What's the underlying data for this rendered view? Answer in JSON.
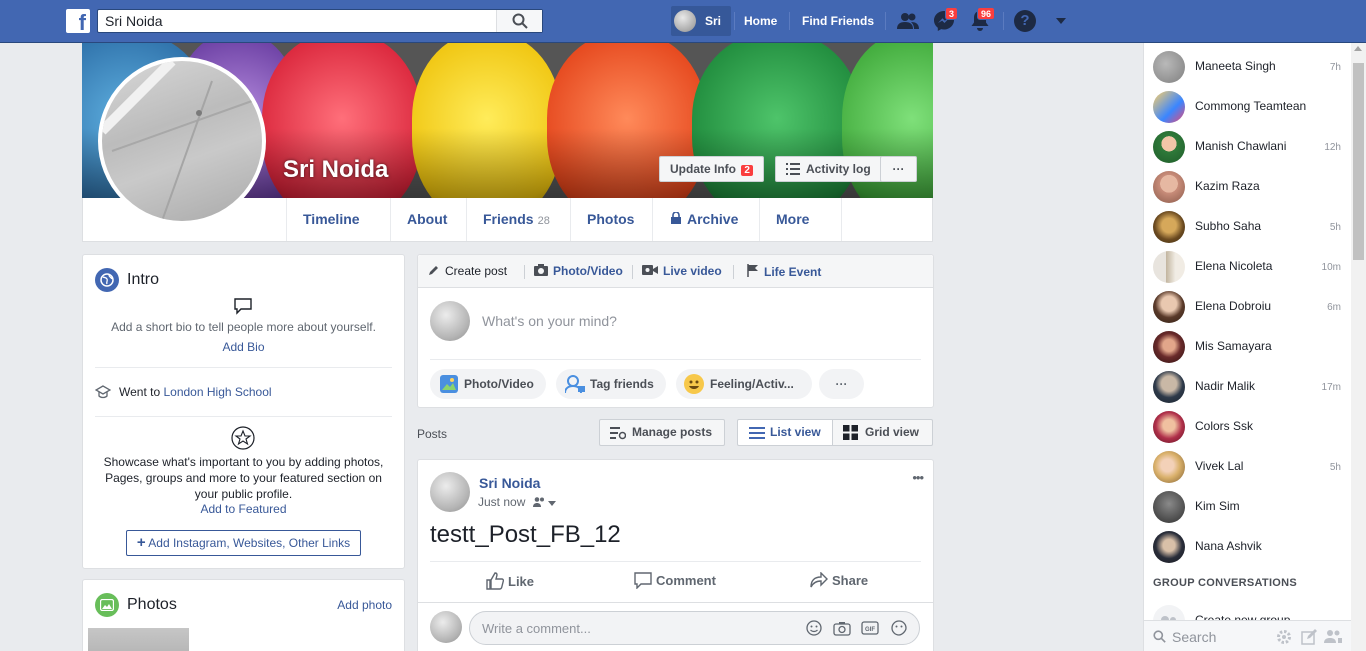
{
  "topbar": {
    "logo": "f",
    "search_value": "Sri Noida",
    "profile_label": "Sri",
    "home_label": "Home",
    "find_friends_label": "Find Friends",
    "messages_badge": "3",
    "notifications_badge": "96",
    "help_label": "?"
  },
  "profile": {
    "name": "Sri Noida",
    "update_info_label": "Update Info",
    "update_info_badge": "2",
    "activity_log_label": "Activity log",
    "more_dots": "···"
  },
  "tabs": {
    "timeline": "Timeline",
    "about": "About",
    "friends": "Friends",
    "friends_count": "28",
    "photos": "Photos",
    "archive": "Archive",
    "more": "More"
  },
  "intro": {
    "title": "Intro",
    "bio_prompt": "Add a short bio to tell people more about yourself.",
    "add_bio": "Add Bio",
    "went_to": "Went to",
    "school": "London High School",
    "featured_text": "Showcase what's important to you by adding photos, Pages, groups and more to your featured section on your public profile.",
    "add_featured": "Add to Featured",
    "add_links": "Add Instagram, Websites, Other Links"
  },
  "photos_card": {
    "title": "Photos",
    "add_photo": "Add photo"
  },
  "composer": {
    "create_post": "Create post",
    "photo_video": "Photo/Video",
    "live_video": "Live video",
    "life_event": "Life Event",
    "placeholder": "What's on your mind?",
    "pill_photo": "Photo/Video",
    "pill_tag": "Tag friends",
    "pill_feeling": "Feeling/Activ...",
    "pill_more": "···"
  },
  "posts_header": {
    "label": "Posts",
    "manage": "Manage posts",
    "list_view": "List view",
    "grid_view": "Grid view"
  },
  "post": {
    "author": "Sri Noida",
    "time": "Just now",
    "text": "testt_Post_FB_12",
    "like": "Like",
    "comment": "Comment",
    "share": "Share",
    "comment_placeholder": "Write a comment...",
    "menu_dots": "•••"
  },
  "chat": {
    "contacts": [
      {
        "name": "Maneeta Singh",
        "time": "7h"
      },
      {
        "name": "Commong Teamtean",
        "time": ""
      },
      {
        "name": "Manish Chawlani",
        "time": "12h"
      },
      {
        "name": "Kazim Raza",
        "time": ""
      },
      {
        "name": "Subho Saha",
        "time": "5h"
      },
      {
        "name": "Elena Nicoleta",
        "time": "10m"
      },
      {
        "name": "Elena Dobroiu",
        "time": "6m"
      },
      {
        "name": "Mis Samayara",
        "time": ""
      },
      {
        "name": "Nadir Malik",
        "time": "17m"
      },
      {
        "name": "Colors Ssk",
        "time": ""
      },
      {
        "name": "Vivek Lal",
        "time": "5h"
      },
      {
        "name": "Kim Sim",
        "time": ""
      },
      {
        "name": "Nana Ashvik",
        "time": ""
      }
    ],
    "group_header": "GROUP CONVERSATIONS",
    "create_group": "Create new group",
    "search_placeholder": "Search"
  },
  "colors": {
    "brand": "#4267b2",
    "link": "#385898",
    "badge": "#fa3e3e"
  }
}
